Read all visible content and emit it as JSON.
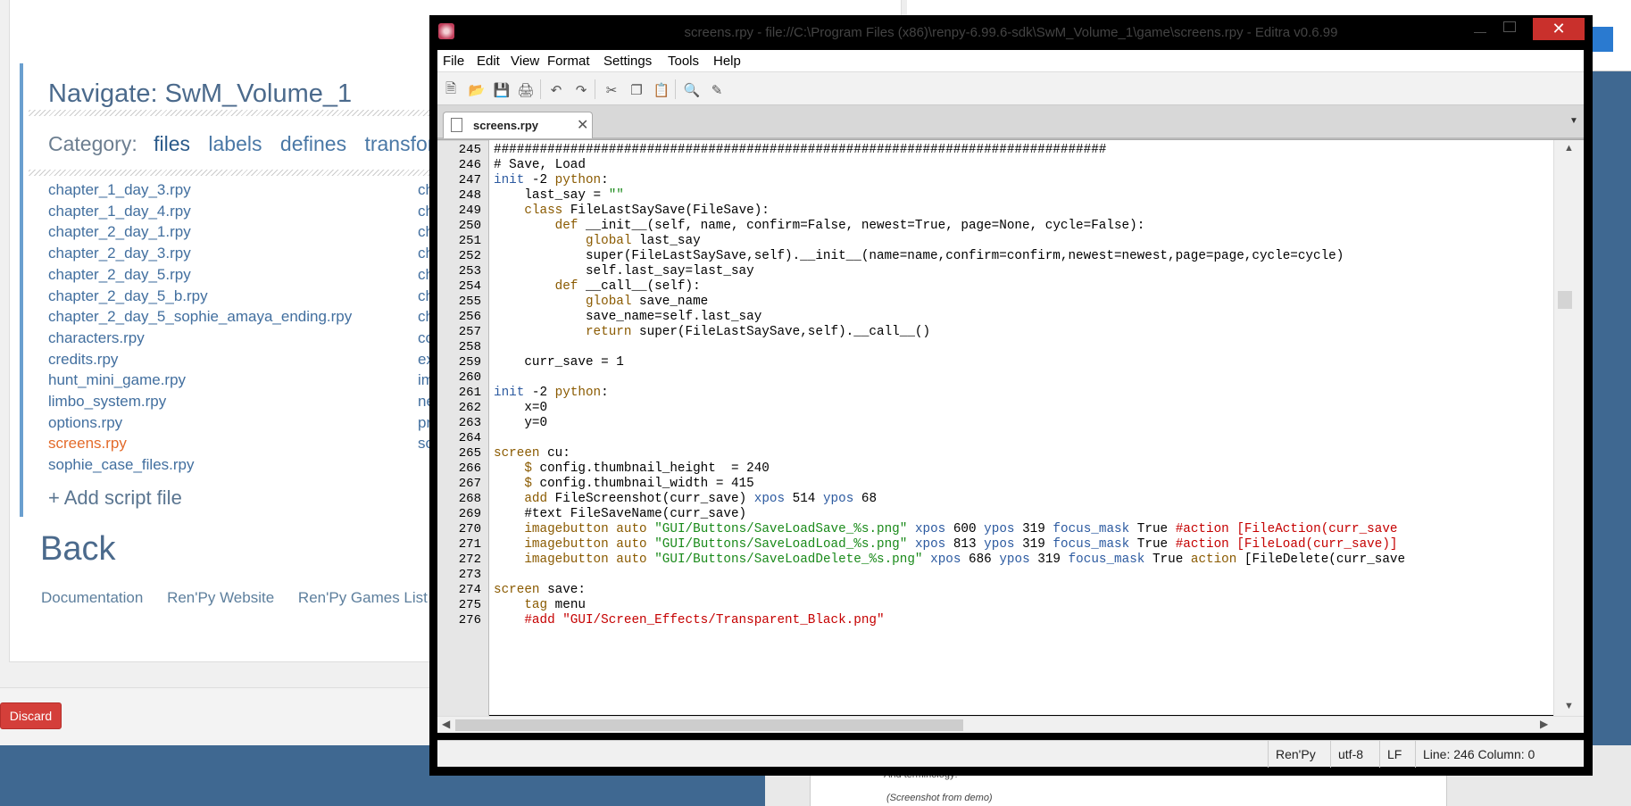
{
  "launcher": {
    "nav_title": "Navigate: SwM_Volume_1",
    "category_label": "Category:",
    "categories": [
      "files",
      "labels",
      "defines",
      "transforms"
    ],
    "files": [
      "chapter_1_day_3.rpy",
      "chapter_1_day_4.rpy",
      "chapter_2_day_1.rpy",
      "chapter_2_day_3.rpy",
      "chapter_2_day_5.rpy",
      "chapter_2_day_5_b.rpy",
      "chapter_2_day_5_sophie_amaya_ending.rpy",
      "characters.rpy",
      "credits.rpy",
      "hunt_mini_game.rpy",
      "limbo_system.rpy",
      "options.rpy",
      "screens.rpy",
      "sophie_case_files.rpy"
    ],
    "active_file": "screens.rpy",
    "col2_fragments": [
      "ch",
      "ch",
      "ch",
      "ch",
      "ch",
      "ch",
      "ch",
      "co",
      "ex",
      "im",
      "ne",
      "pr",
      "sc"
    ],
    "add_file": "+ Add script file",
    "back": "Back",
    "links": [
      "Documentation",
      "Ren'Py Website",
      "Ren'Py Games List"
    ],
    "discard": "Discard"
  },
  "background_doc": {
    "line1": "And terminology:",
    "line2": "(Screenshot from demo)"
  },
  "editra": {
    "title": "screens.rpy - file://C:\\Program Files (x86)\\renpy-6.99.6-sdk\\SwM_Volume_1\\game\\screens.rpy - Editra v0.6.99",
    "menu": [
      "File",
      "Edit",
      "View",
      "Format",
      "Settings",
      "Tools",
      "Help"
    ],
    "tab_label": "screens.rpy",
    "line_numbers": [
      "245",
      "246",
      "247",
      "248",
      "249",
      "250",
      "251",
      "252",
      "253",
      "254",
      "255",
      "256",
      "257",
      "258",
      "259",
      "260",
      "261",
      "262",
      "263",
      "264",
      "265",
      "266",
      "267",
      "268",
      "269",
      "270",
      "271",
      "272",
      "273",
      "274",
      "275",
      "276"
    ],
    "status": {
      "language": "Ren'Py",
      "encoding": "utf-8",
      "eol": "LF",
      "position": "Line: 246  Column: 0"
    }
  }
}
